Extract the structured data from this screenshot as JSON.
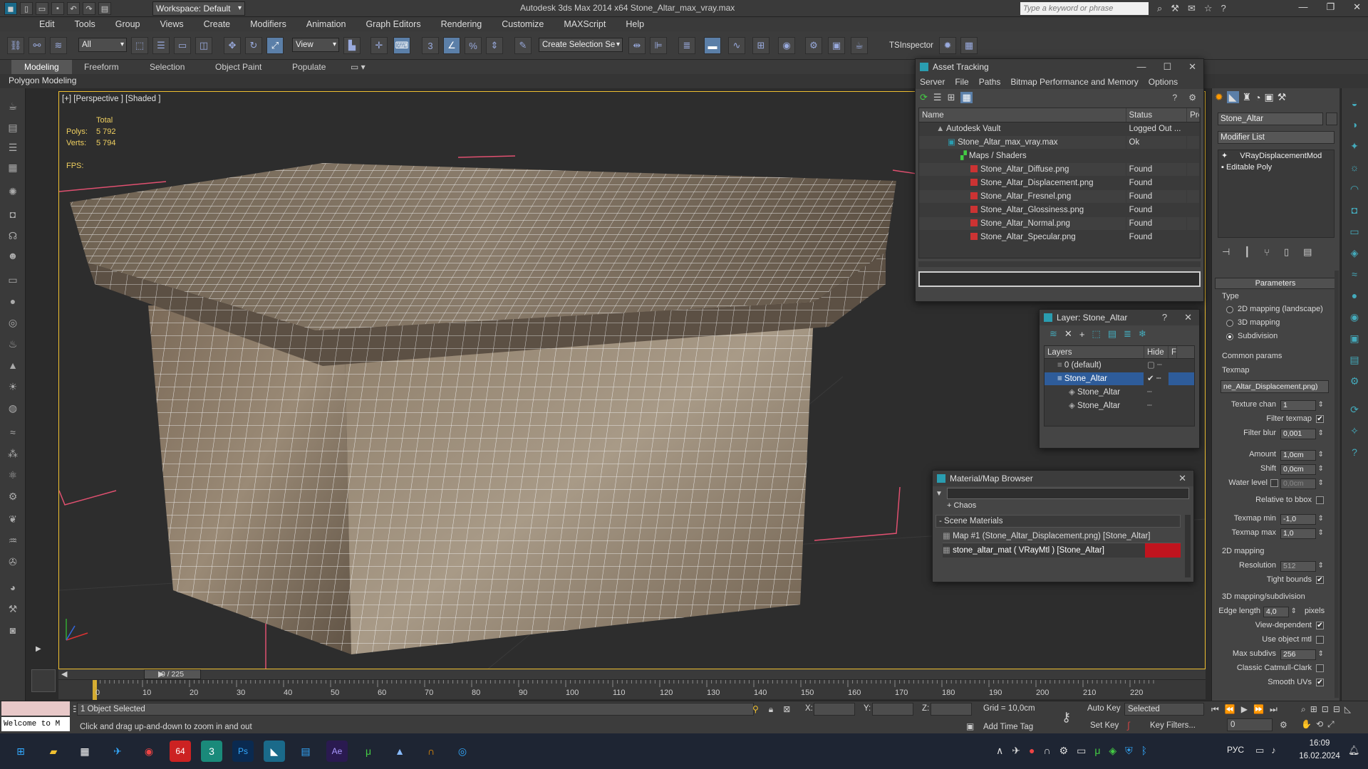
{
  "titlebar": {
    "workspace": "Workspace: Default",
    "title": "Autodesk 3ds Max  2014 x64      Stone_Altar_max_vray.max",
    "search_placeholder": "Type a keyword or phrase",
    "minimize": "—",
    "maximize": "❐",
    "close": "✕"
  },
  "menu": [
    "Edit",
    "Tools",
    "Group",
    "Views",
    "Create",
    "Modifiers",
    "Animation",
    "Graph Editors",
    "Rendering",
    "Customize",
    "MAXScript",
    "Help"
  ],
  "toolbar": {
    "selection_filter": "All",
    "ref_coord": "View",
    "named_selection": "Create Selection Se",
    "tsinspector": "TSInspector"
  },
  "ribbon": {
    "tabs": [
      "Modeling",
      "Freeform",
      "Selection",
      "Object Paint",
      "Populate"
    ],
    "active_tab": "Modeling",
    "panel_label": "Polygon Modeling"
  },
  "viewport": {
    "label": "[+] [Perspective ] [Shaded ]",
    "stats_total": "Total",
    "polys_label": "Polys:",
    "polys_value": "5 792",
    "verts_label": "Verts:",
    "verts_value": "5 794",
    "fps_label": "FPS:"
  },
  "asset_tracking": {
    "title": "Asset Tracking",
    "menu": [
      "Server",
      "File",
      "Paths",
      "Bitmap Performance and Memory",
      "Options"
    ],
    "col_name": "Name",
    "col_status": "Status",
    "col_pr": "Pro",
    "rows": [
      {
        "name": "Autodesk Vault",
        "status": "Logged Out ..."
      },
      {
        "name": "Stone_Altar_max_vray.max",
        "status": "Ok"
      },
      {
        "name": "Maps / Shaders",
        "status": ""
      },
      {
        "name": "Stone_Altar_Diffuse.png",
        "status": "Found"
      },
      {
        "name": "Stone_Altar_Displacement.png",
        "status": "Found"
      },
      {
        "name": "Stone_Altar_Fresnel.png",
        "status": "Found"
      },
      {
        "name": "Stone_Altar_Glossiness.png",
        "status": "Found"
      },
      {
        "name": "Stone_Altar_Normal.png",
        "status": "Found"
      },
      {
        "name": "Stone_Altar_Specular.png",
        "status": "Found"
      }
    ]
  },
  "layer_window": {
    "title": "Layer: Stone_Altar",
    "help": "?",
    "col_layers": "Layers",
    "col_hide": "Hide",
    "col_f": "F",
    "rows": [
      {
        "name": "0 (default)"
      },
      {
        "name": "Stone_Altar"
      },
      {
        "name": "Stone_Altar"
      },
      {
        "name": "Stone_Altar"
      }
    ]
  },
  "material_browser": {
    "title": "Material/Map Browser",
    "group_chaos": "+ Chaos",
    "group_scene": "- Scene Materials",
    "items": [
      "Map #1 (Stone_Altar_Displacement.png)  [Stone_Altar]",
      "stone_altar_mat  ( VRayMtl )  [Stone_Altar]"
    ]
  },
  "command_panel": {
    "object_name": "Stone_Altar",
    "modifier_list": "Modifier List",
    "stack": [
      "VRayDisplacementMod",
      "Editable Poly"
    ],
    "rollout": "Parameters",
    "type_label": "Type",
    "type_options": [
      "2D mapping (landscape)",
      "3D mapping",
      "Subdivision"
    ],
    "type_selected": 2,
    "common_params": "Common params",
    "texmap_label": "Texmap",
    "texmap_value": "ne_Altar_Displacement.png)",
    "texture_chan_label": "Texture chan",
    "texture_chan_value": "1",
    "filter_texmap_label": "Filter texmap",
    "filter_blur_label": "Filter blur",
    "filter_blur_value": "0,001",
    "amount_label": "Amount",
    "amount_value": "1,0cm",
    "shift_label": "Shift",
    "shift_value": "0,0cm",
    "water_level_label": "Water level",
    "water_level_value": "0,0cm",
    "relative_bbox_label": "Relative to bbox",
    "texmap_min_label": "Texmap min",
    "texmap_min_value": "-1,0",
    "texmap_max_label": "Texmap max",
    "texmap_max_value": "1,0",
    "mapping2d_label": "2D mapping",
    "resolution_label": "Resolution",
    "resolution_value": "512",
    "tight_bounds_label": "Tight bounds",
    "mapping3d_label": "3D mapping/subdivision",
    "edge_length_label": "Edge length",
    "edge_length_value": "4,0",
    "pixels_label": "pixels",
    "view_dependent_label": "View-dependent",
    "use_object_mtl_label": "Use object mtl",
    "max_subdivs_label": "Max subdivs",
    "max_subdivs_value": "256",
    "catmull_label": "Classic Catmull-Clark",
    "smooth_uvs_label": "Smooth UVs"
  },
  "timeline": {
    "frame_counter": "0 / 225",
    "ticks": [
      "0",
      "10",
      "20",
      "30",
      "40",
      "50",
      "60",
      "70",
      "80",
      "90",
      "100",
      "110",
      "120",
      "130",
      "140",
      "150",
      "160",
      "170",
      "180",
      "190",
      "200",
      "210",
      "220"
    ]
  },
  "statusbar": {
    "welcome": "Welcome to M",
    "selected": "1 Object Selected",
    "prompt": "Click and drag up-and-down to zoom in and out",
    "x_label": "X:",
    "y_label": "Y:",
    "z_label": "Z:",
    "grid": "Grid = 10,0cm",
    "add_time_tag": "Add Time Tag",
    "auto_key": "Auto Key",
    "set_key": "Set Key",
    "key_mode": "Selected",
    "key_filters": "Key Filters...",
    "frame": "0"
  },
  "taskbar": {
    "lang": "РУС",
    "time": "16:09",
    "date": "16.02.2024"
  }
}
